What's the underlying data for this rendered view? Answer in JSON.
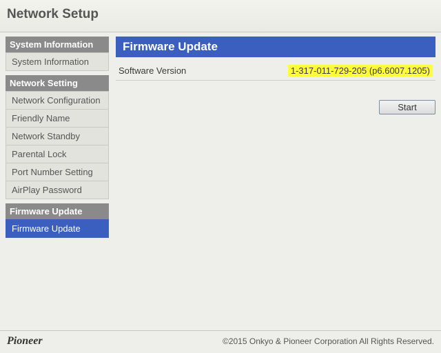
{
  "header": {
    "title": "Network Setup"
  },
  "sidebar": {
    "sections": [
      {
        "heading": "System Information",
        "items": [
          {
            "label": "System Information",
            "selected": false
          }
        ]
      },
      {
        "heading": "Network Setting",
        "items": [
          {
            "label": "Network Configuration",
            "selected": false
          },
          {
            "label": "Friendly Name",
            "selected": false
          },
          {
            "label": "Network Standby",
            "selected": false
          },
          {
            "label": "Parental Lock",
            "selected": false
          },
          {
            "label": "Port Number Setting",
            "selected": false
          },
          {
            "label": "AirPlay Password",
            "selected": false
          }
        ]
      },
      {
        "heading": "Firmware Update",
        "items": [
          {
            "label": "Firmware Update",
            "selected": true
          }
        ]
      }
    ]
  },
  "main": {
    "panel_title": "Firmware Update",
    "rows": [
      {
        "label": "Software Version",
        "value": "1-317-011-729-205 (p6.6007.1205)",
        "highlight": true
      }
    ],
    "start_label": "Start"
  },
  "footer": {
    "brand": "Pioneer",
    "copyright": "©2015 Onkyo & Pioneer Corporation All Rights Reserved."
  }
}
